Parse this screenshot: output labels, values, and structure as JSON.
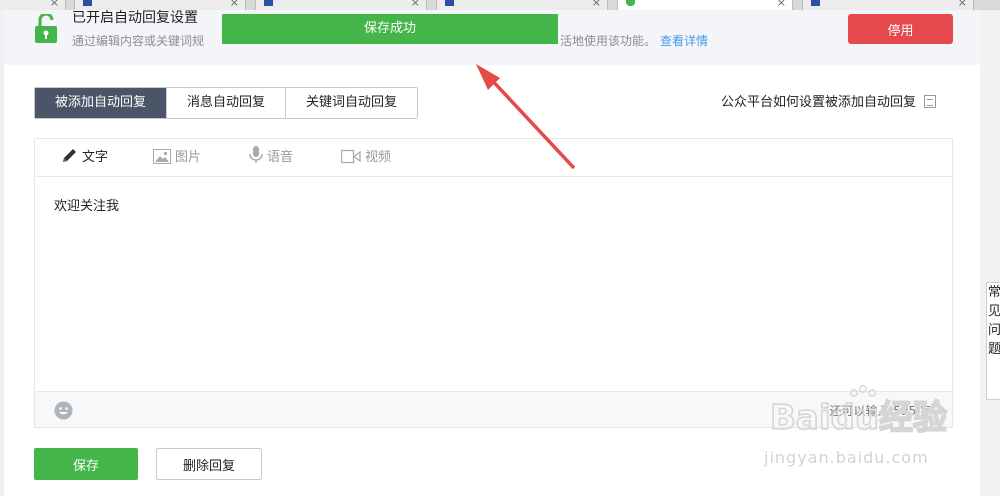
{
  "browser": {
    "tabs": [
      {
        "title": "",
        "active": false
      },
      {
        "title": "",
        "active": false
      },
      {
        "title": "",
        "active": false
      },
      {
        "title": "",
        "active": false
      },
      {
        "title": "",
        "active": false
      },
      {
        "title": "",
        "active": true
      },
      {
        "title": "",
        "active": false
      }
    ]
  },
  "notice": {
    "title": "已开启自动回复设置",
    "desc": "通过编辑内容或关键词规",
    "desc_tail": "活地使用该功能。",
    "detail_link": "查看详情",
    "stop_button": "停用"
  },
  "toast": {
    "text": "保存成功"
  },
  "reply_tabs": [
    {
      "label": "被添加自动回复",
      "active": true
    },
    {
      "label": "消息自动回复",
      "active": false
    },
    {
      "label": "关键词自动回复",
      "active": false
    }
  ],
  "help_link": "公众平台如何设置被添加自动回复",
  "editor": {
    "tools": [
      {
        "label": "文字",
        "icon": "pencil-icon",
        "active": true
      },
      {
        "label": "图片",
        "icon": "image-icon",
        "active": false
      },
      {
        "label": "语音",
        "icon": "microphone-icon",
        "active": false
      },
      {
        "label": "视频",
        "icon": "video-icon",
        "active": false
      }
    ],
    "content": "欢迎关注我",
    "counter": "还可以输入 595 字"
  },
  "actions": {
    "save": "保存",
    "delete": "删除回复"
  },
  "side_tip": [
    "常",
    "见",
    "问",
    "题"
  ],
  "watermark": {
    "logo": "Baidu经验",
    "url": "jingyan.baidu.com"
  },
  "colors": {
    "brand_green": "#44b549",
    "danger_red": "#e5484d",
    "tab_active": "#4a5668",
    "link_blue": "#459ae9"
  }
}
